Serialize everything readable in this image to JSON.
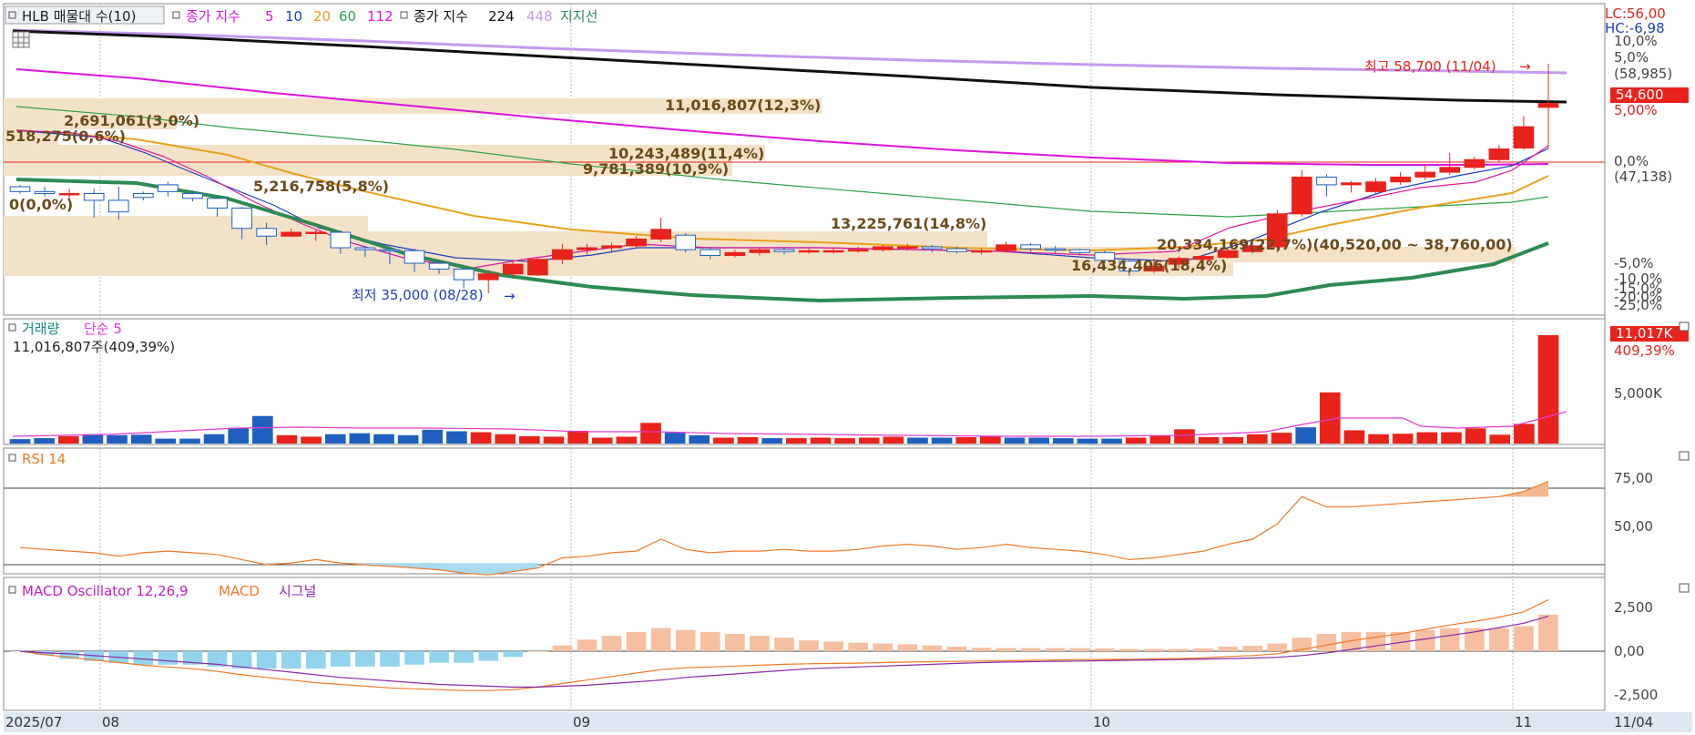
{
  "price_panel": {
    "title": "HLB 매물대 수(10)",
    "legend_ma_prefix": "종가 지수",
    "ma_periods": [
      "5",
      "10",
      "20",
      "60",
      "112"
    ],
    "legend_ma2_prefix": "종가 지수",
    "ma2_periods": [
      "224",
      "448"
    ],
    "legend_support": "지지선",
    "lc": "LC:56,00",
    "hc": "HC:-6,98",
    "high_note": "최고 58,700 (11/04)",
    "low_note": "최저 35,000 (08/28)",
    "current_price": "54,600",
    "right_labels": [
      "10,0%",
      "5,0%",
      "(58,985)",
      "5,00%",
      "0,0%",
      "(47,138)",
      "-5,0%",
      "-10,0%",
      "-15,0%",
      "-20,0%",
      "-25,0%"
    ],
    "volume_profile": [
      "11,016,807(12,3%)",
      "2,691,061(3,0%)",
      "518,275(0,6%)",
      "10,243,489(11,4%)",
      "9,781,389(10,9%)",
      "0(0,0%)",
      "5,216,758(5,8%)",
      "13,225,761(14,8%)",
      "20,334,169(22,7%)(40,520,00 ~ 38,760,00)",
      "16,434,406(18,4%)"
    ]
  },
  "volume_panel": {
    "title": "거래량",
    "ma_label": "단순 5",
    "info": "11,016,807주(409,39%)",
    "current_value": "11,017K",
    "current_pct": "409,39%",
    "axis_label": "5,000K"
  },
  "rsi_panel": {
    "title": "RSI 14",
    "axis_labels": [
      "75,00",
      "50,00"
    ]
  },
  "macd_panel": {
    "title": "MACD Oscillator 12,26,9",
    "macd_label": "MACD",
    "signal_label": "시그널",
    "axis_labels": [
      "2,500",
      "0,00",
      "-2,500"
    ]
  },
  "x_axis": {
    "labels": [
      "2025/07",
      "08",
      "09",
      "10",
      "11",
      "11/04"
    ]
  },
  "colors": {
    "up": "#e8231c",
    "down": "#1f5fbf",
    "ma5": "#e0189f",
    "ma10": "#1f3fbf",
    "ma20": "#e8a21a",
    "ma60": "#2ca24a",
    "ma112": "#dd14dd",
    "ma224": "#111111",
    "ma448": "#c49af0",
    "support": "#2e8a53",
    "profile": "#f4e2c8",
    "rsi": "#f07a28",
    "macd": "#f07a28",
    "signal": "#8a2aa8",
    "osc_pos": "#f6bfa1",
    "osc_neg": "#92d3ee",
    "volma": "#e03ad0"
  },
  "chart_data": [
    {
      "type": "candlestick",
      "x": [
        "07/31",
        "08/01",
        "08/04",
        "08/05",
        "08/06",
        "08/07",
        "08/08",
        "08/11",
        "08/12",
        "08/13",
        "08/14",
        "08/18",
        "08/19",
        "08/20",
        "08/21",
        "08/22",
        "08/25",
        "08/26",
        "08/27",
        "08/28",
        "08/29",
        "09/01",
        "09/02",
        "09/03",
        "09/04",
        "09/05",
        "09/08",
        "09/09",
        "09/10",
        "09/11",
        "09/12",
        "09/15",
        "09/16",
        "09/17",
        "09/18",
        "09/19",
        "09/22",
        "09/23",
        "09/24",
        "09/25",
        "09/26",
        "09/29",
        "09/30",
        "10/01",
        "10/02",
        "10/10",
        "10/13",
        "10/14",
        "10/15",
        "10/16",
        "10/17",
        "10/20",
        "10/21",
        "10/22",
        "10/23",
        "10/24",
        "10/27",
        "10/28",
        "10/29",
        "10/30",
        "10/31",
        "11/03",
        "11/04"
      ],
      "open": [
        46.0,
        45.5,
        45.3,
        45.3,
        44.6,
        45.3,
        46.2,
        45.3,
        44.8,
        43.8,
        41.7,
        40.9,
        41.3,
        41.3,
        39.7,
        39.5,
        39.4,
        38.1,
        37.5,
        36.4,
        37.0,
        36.9,
        38.5,
        39.5,
        39.7,
        39.9,
        40.6,
        41.0,
        39.5,
        38.9,
        39.2,
        39.5,
        39.3,
        39.4,
        39.4,
        39.5,
        39.8,
        39.8,
        39.6,
        39.3,
        39.4,
        40.0,
        39.6,
        39.5,
        39.2,
        38.3,
        37.3,
        38.0,
        38.5,
        38.7,
        39.3,
        39.8,
        43.2,
        47.0,
        46.2,
        45.5,
        46.5,
        47.0,
        47.5,
        48.0,
        48.8,
        50.0,
        54.2
      ],
      "close": [
        45.5,
        45.3,
        45.3,
        44.6,
        43.4,
        44.9,
        45.5,
        44.8,
        43.8,
        41.7,
        40.9,
        41.3,
        41.3,
        39.7,
        39.5,
        39.4,
        38.1,
        37.5,
        36.4,
        37.0,
        38.0,
        38.5,
        39.5,
        39.7,
        39.9,
        40.6,
        41.6,
        39.5,
        38.9,
        39.2,
        39.5,
        39.3,
        39.4,
        39.4,
        39.5,
        39.8,
        39.8,
        39.6,
        39.3,
        39.4,
        40.0,
        39.6,
        39.5,
        39.2,
        38.4,
        37.3,
        37.8,
        38.6,
        38.8,
        39.4,
        39.9,
        43.2,
        47.0,
        46.2,
        46.4,
        46.5,
        47.0,
        47.5,
        48.0,
        48.8,
        49.9,
        52.2,
        54.6
      ],
      "high": [
        46.2,
        46.0,
        45.8,
        45.8,
        46.0,
        45.5,
        46.5,
        45.6,
        45.0,
        43.9,
        42.3,
        41.7,
        41.6,
        41.5,
        39.9,
        39.8,
        39.6,
        38.3,
        37.6,
        37.4,
        38.3,
        38.7,
        40.1,
        40.1,
        40.2,
        40.9,
        42.8,
        41.2,
        39.8,
        39.5,
        39.7,
        39.8,
        39.6,
        39.7,
        39.8,
        40.0,
        40.1,
        40.0,
        39.8,
        39.6,
        40.3,
        40.2,
        39.9,
        39.6,
        39.4,
        38.4,
        38.6,
        38.8,
        39.0,
        39.6,
        40.2,
        43.6,
        47.7,
        47.3,
        46.6,
        46.9,
        47.5,
        48.3,
        49.5,
        49.1,
        50.3,
        53.3,
        58.7
      ],
      "low": [
        45.3,
        45.0,
        44.6,
        42.8,
        42.6,
        44.6,
        45.0,
        44.5,
        42.9,
        40.6,
        40.0,
        40.8,
        40.4,
        39.1,
        38.7,
        38.0,
        37.2,
        37.0,
        35.5,
        35.0,
        36.6,
        36.8,
        38.0,
        39.0,
        39.3,
        39.7,
        40.3,
        39.2,
        38.5,
        38.7,
        38.9,
        39.0,
        39.1,
        39.1,
        39.2,
        39.3,
        39.4,
        39.2,
        39.1,
        39.0,
        39.2,
        39.3,
        39.2,
        38.9,
        38.2,
        36.8,
        37.1,
        37.6,
        38.3,
        38.6,
        39.1,
        39.6,
        42.9,
        45.0,
        45.4,
        45.3,
        46.2,
        46.7,
        47.2,
        47.8,
        48.5,
        49.8,
        49.9
      ],
      "ylabel": ""
    },
    {
      "type": "bar",
      "title": "거래량",
      "values": [
        0.45,
        0.55,
        0.75,
        0.95,
        0.85,
        0.9,
        0.5,
        0.5,
        0.95,
        1.6,
        2.8,
        0.85,
        0.7,
        0.95,
        1.05,
        0.95,
        0.85,
        1.4,
        1.25,
        1.15,
        0.95,
        0.75,
        0.7,
        1.3,
        0.6,
        0.7,
        2.1,
        1.1,
        0.85,
        0.6,
        0.65,
        0.55,
        0.55,
        0.6,
        0.55,
        0.6,
        0.7,
        0.6,
        0.6,
        0.65,
        0.7,
        0.6,
        0.6,
        0.55,
        0.5,
        0.5,
        0.6,
        0.8,
        1.45,
        0.65,
        0.65,
        0.95,
        1.1,
        1.65,
        5.2,
        1.35,
        0.95,
        1.0,
        1.15,
        1.15,
        1.55,
        0.9,
        2.0,
        11.017
      ],
      "unit": "백만주"
    },
    {
      "type": "line",
      "title": "RSI 14",
      "values": [
        40,
        39,
        38,
        37,
        35,
        37,
        38,
        37,
        36,
        33,
        30,
        31,
        33,
        31,
        30,
        29,
        28,
        27,
        25,
        24,
        26,
        28,
        34,
        35,
        37,
        38,
        45,
        39,
        37,
        38,
        38,
        39,
        38,
        38,
        39,
        41,
        42,
        41,
        39,
        40,
        42,
        40,
        39,
        38,
        36,
        33,
        34,
        36,
        38,
        42,
        45,
        54,
        70,
        64,
        64,
        65,
        66,
        67,
        68,
        69,
        70,
        73,
        79
      ],
      "ylim": [
        0,
        100
      ]
    },
    {
      "type": "line",
      "title": "MACD",
      "series": [
        {
          "name": "MACD",
          "values": [
            0,
            -200,
            -350,
            -500,
            -650,
            -800,
            -900,
            -1000,
            -1150,
            -1350,
            -1500,
            -1650,
            -1800,
            -1900,
            -2000,
            -2100,
            -2150,
            -2200,
            -2250,
            -2250,
            -2200,
            -2050,
            -1850,
            -1650,
            -1450,
            -1250,
            -1050,
            -950,
            -900,
            -850,
            -800,
            -750,
            -720,
            -700,
            -680,
            -650,
            -620,
            -600,
            -580,
            -560,
            -540,
            -520,
            -500,
            -480,
            -470,
            -460,
            -440,
            -420,
            -380,
            -300,
            -250,
            -150,
            100,
            350,
            600,
            800,
            1000,
            1250,
            1500,
            1700,
            1950,
            2250,
            2950
          ]
        },
        {
          "name": "시그널",
          "values": [
            0,
            -100,
            -150,
            -250,
            -350,
            -450,
            -550,
            -650,
            -750,
            -900,
            -1050,
            -1200,
            -1350,
            -1500,
            -1600,
            -1700,
            -1800,
            -1900,
            -1950,
            -2000,
            -2050,
            -2050,
            -2000,
            -1950,
            -1850,
            -1750,
            -1650,
            -1500,
            -1400,
            -1300,
            -1200,
            -1100,
            -1000,
            -950,
            -900,
            -850,
            -800,
            -750,
            -700,
            -650,
            -620,
            -600,
            -580,
            -560,
            -540,
            -520,
            -500,
            -480,
            -450,
            -420,
            -390,
            -350,
            -250,
            -100,
            100,
            300,
            500,
            700,
            900,
            1100,
            1350,
            1600,
            2000
          ]
        }
      ],
      "ylim": [
        -3000,
        3500
      ]
    }
  ]
}
